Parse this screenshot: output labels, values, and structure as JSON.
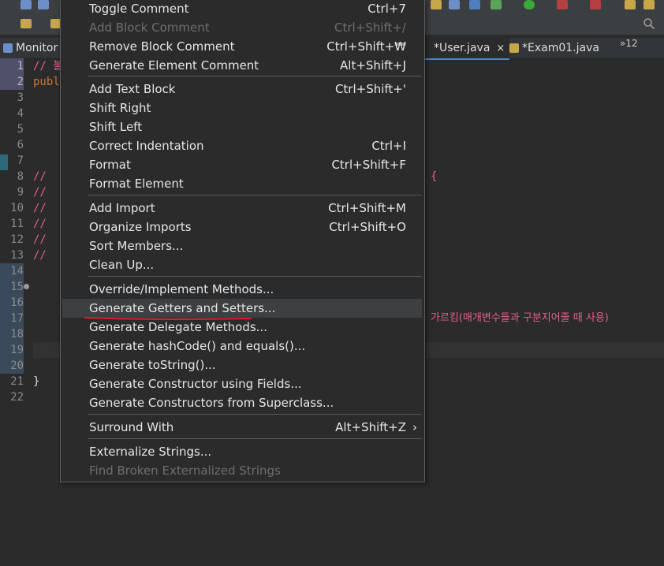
{
  "tabs": [
    {
      "label": "Monitor"
    },
    {
      "label": "*User.java",
      "close": "×"
    },
    {
      "label": "*Exam01.java"
    }
  ],
  "tab_overflow": "»12",
  "line_numbers": [
    "1",
    "2",
    "3",
    "4",
    "5",
    "6",
    "7",
    "8",
    "9",
    "10",
    "11",
    "12",
    "13",
    "14",
    "15",
    "16",
    "17",
    "18",
    "19",
    "20",
    "21",
    "22"
  ],
  "code": {
    "line1": "// 불",
    "line2": "publ",
    "line8": "//",
    "line8_right": "{",
    "line9": "//",
    "line10": "//",
    "line11": "//",
    "line12": "//",
    "line13": "//",
    "line17_right": "가르킴(매개변수들과 구분지어줄 때 사용)",
    "line21": "}"
  },
  "menu": {
    "group1": [
      {
        "label": "Toggle Comment",
        "shortcut": "Ctrl+7",
        "disabled": false
      },
      {
        "label": "Add Block Comment",
        "shortcut": "Ctrl+Shift+/",
        "disabled": true
      },
      {
        "label": "Remove Block Comment",
        "shortcut": "Ctrl+Shift+₩",
        "disabled": false
      },
      {
        "label": "Generate Element Comment",
        "shortcut": "Alt+Shift+J",
        "disabled": false
      }
    ],
    "group2": [
      {
        "label": "Add Text Block",
        "shortcut": "Ctrl+Shift+'"
      },
      {
        "label": "Shift Right",
        "shortcut": ""
      },
      {
        "label": "Shift Left",
        "shortcut": ""
      },
      {
        "label": "Correct Indentation",
        "shortcut": "Ctrl+I"
      },
      {
        "label": "Format",
        "shortcut": "Ctrl+Shift+F"
      },
      {
        "label": "Format Element",
        "shortcut": ""
      }
    ],
    "group3": [
      {
        "label": "Add Import",
        "shortcut": "Ctrl+Shift+M"
      },
      {
        "label": "Organize Imports",
        "shortcut": "Ctrl+Shift+O"
      },
      {
        "label": "Sort Members...",
        "shortcut": ""
      },
      {
        "label": "Clean Up...",
        "shortcut": ""
      }
    ],
    "group4": [
      {
        "label": "Override/Implement Methods...",
        "shortcut": ""
      },
      {
        "label": "Generate Getters and Setters...",
        "shortcut": ""
      },
      {
        "label": "Generate Delegate Methods...",
        "shortcut": ""
      },
      {
        "label": "Generate hashCode() and equals()...",
        "shortcut": ""
      },
      {
        "label": "Generate toString()...",
        "shortcut": ""
      },
      {
        "label": "Generate Constructor using Fields...",
        "shortcut": ""
      },
      {
        "label": "Generate Constructors from Superclass...",
        "shortcut": ""
      }
    ],
    "group5": [
      {
        "label": "Surround With",
        "shortcut": "Alt+Shift+Z",
        "submenu": "›"
      }
    ],
    "group6": [
      {
        "label": "Externalize Strings...",
        "shortcut": "",
        "disabled": false
      },
      {
        "label": "Find Broken Externalized Strings",
        "shortcut": "",
        "disabled": true
      }
    ]
  },
  "colors": {
    "underline": "#d8202a",
    "accent": "#4a88c7"
  }
}
